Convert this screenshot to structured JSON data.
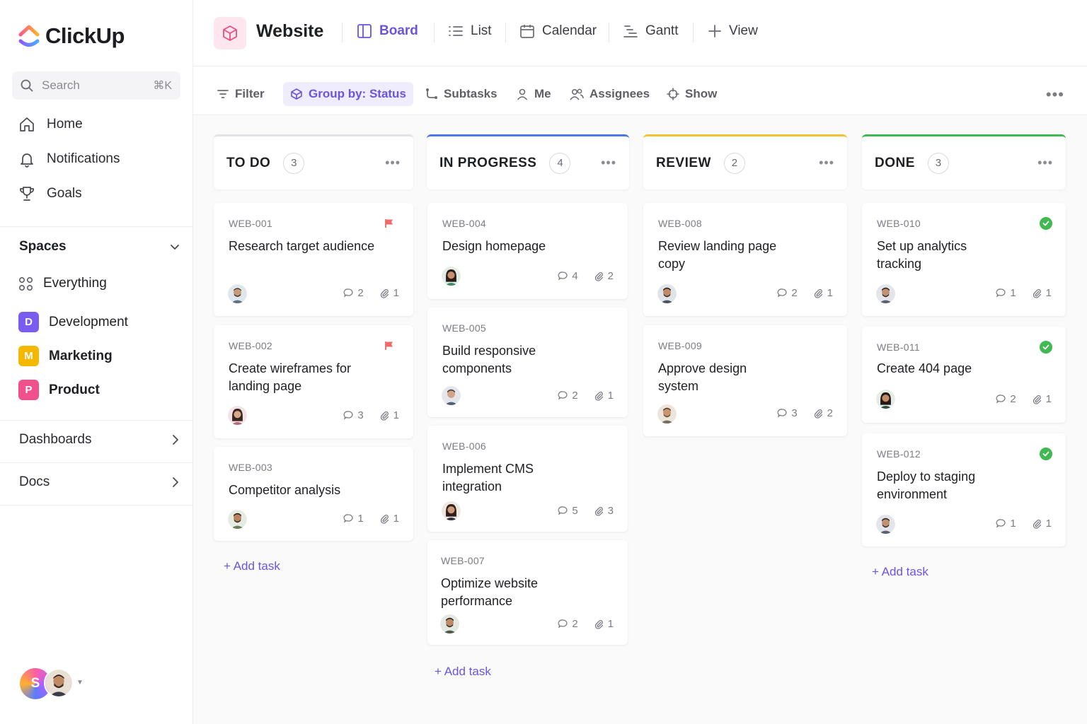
{
  "app": {
    "name": "ClickUp"
  },
  "search": {
    "placeholder": "Search",
    "shortcut": "⌘K"
  },
  "nav": {
    "home": "Home",
    "notifications": "Notifications",
    "goals": "Goals"
  },
  "spaces": {
    "heading": "Spaces",
    "everything": "Everything",
    "items": [
      {
        "letter": "D",
        "label": "Development",
        "color": "#7b5cf0"
      },
      {
        "letter": "M",
        "label": "Marketing",
        "color": "#f5b800"
      },
      {
        "letter": "P",
        "label": "Product",
        "color": "#f0508c"
      }
    ]
  },
  "sidebar_links": {
    "dashboards": "Dashboards",
    "docs": "Docs"
  },
  "user": {
    "initial": "S"
  },
  "header": {
    "title": "Website",
    "views": {
      "board": "Board",
      "list": "List",
      "calendar": "Calendar",
      "gantt": "Gantt",
      "add_view": "View"
    }
  },
  "toolbar": {
    "filter": "Filter",
    "group_by": "Group by: Status",
    "subtasks": "Subtasks",
    "me": "Me",
    "assignees": "Assignees",
    "show": "Show"
  },
  "board": {
    "add_task": "+ Add task",
    "columns": [
      {
        "name": "TO DO",
        "count": "3",
        "accent": "#e3e3e7",
        "cards": [
          {
            "id": "WEB-001",
            "title": "Research target audience",
            "comments": "2",
            "attachments": "1",
            "flag": true
          },
          {
            "id": "WEB-002",
            "title": "Create wireframes for landing page",
            "comments": "3",
            "attachments": "1",
            "flag": true
          },
          {
            "id": "WEB-003",
            "title": "Competitor analysis",
            "comments": "1",
            "attachments": "1"
          }
        ]
      },
      {
        "name": "IN PROGRESS",
        "count": "4",
        "accent": "#4a78e8",
        "cards": [
          {
            "id": "WEB-004",
            "title": "Design homepage",
            "comments": "4",
            "attachments": "2"
          },
          {
            "id": "WEB-005",
            "title": "Build responsive components",
            "comments": "2",
            "attachments": "1"
          },
          {
            "id": "WEB-006",
            "title": "Implement CMS integration",
            "comments": "5",
            "attachments": "3"
          },
          {
            "id": "WEB-007",
            "title": "Optimize website performance",
            "comments": "2",
            "attachments": "1"
          }
        ]
      },
      {
        "name": "REVIEW",
        "count": "2",
        "accent": "#f2c232",
        "cards": [
          {
            "id": "WEB-008",
            "title": "Review landing page copy",
            "comments": "2",
            "attachments": "1"
          },
          {
            "id": "WEB-009",
            "title": "Approve design system",
            "comments": "3",
            "attachments": "2"
          }
        ]
      },
      {
        "name": "DONE",
        "count": "3",
        "accent": "#3fb950",
        "cards": [
          {
            "id": "WEB-010",
            "title": "Set up analytics tracking",
            "comments": "1",
            "attachments": "1",
            "done": true
          },
          {
            "id": "WEB-011",
            "title": "Create 404 page",
            "comments": "2",
            "attachments": "1",
            "done": true
          },
          {
            "id": "WEB-012",
            "title": "Deploy to staging environment",
            "comments": "1",
            "attachments": "1",
            "done": true
          }
        ]
      }
    ]
  }
}
